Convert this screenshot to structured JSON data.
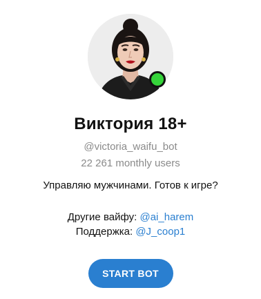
{
  "bot": {
    "name": "Виктория 18+",
    "username": "@victoria_waifu_bot",
    "monthly_users": "22 261 monthly users",
    "description": "Управляю мужчинами. Готов к игре?",
    "online": true
  },
  "links": [
    {
      "label": "Другие вайфу: ",
      "mention": "@ai_harem"
    },
    {
      "label": "Поддержка: ",
      "mention": "@J_coop1"
    }
  ],
  "actions": {
    "start_label": "START BOT"
  },
  "colors": {
    "accent": "#2a7fd0",
    "online": "#35d43a",
    "muted_text": "#8a8a8a"
  }
}
